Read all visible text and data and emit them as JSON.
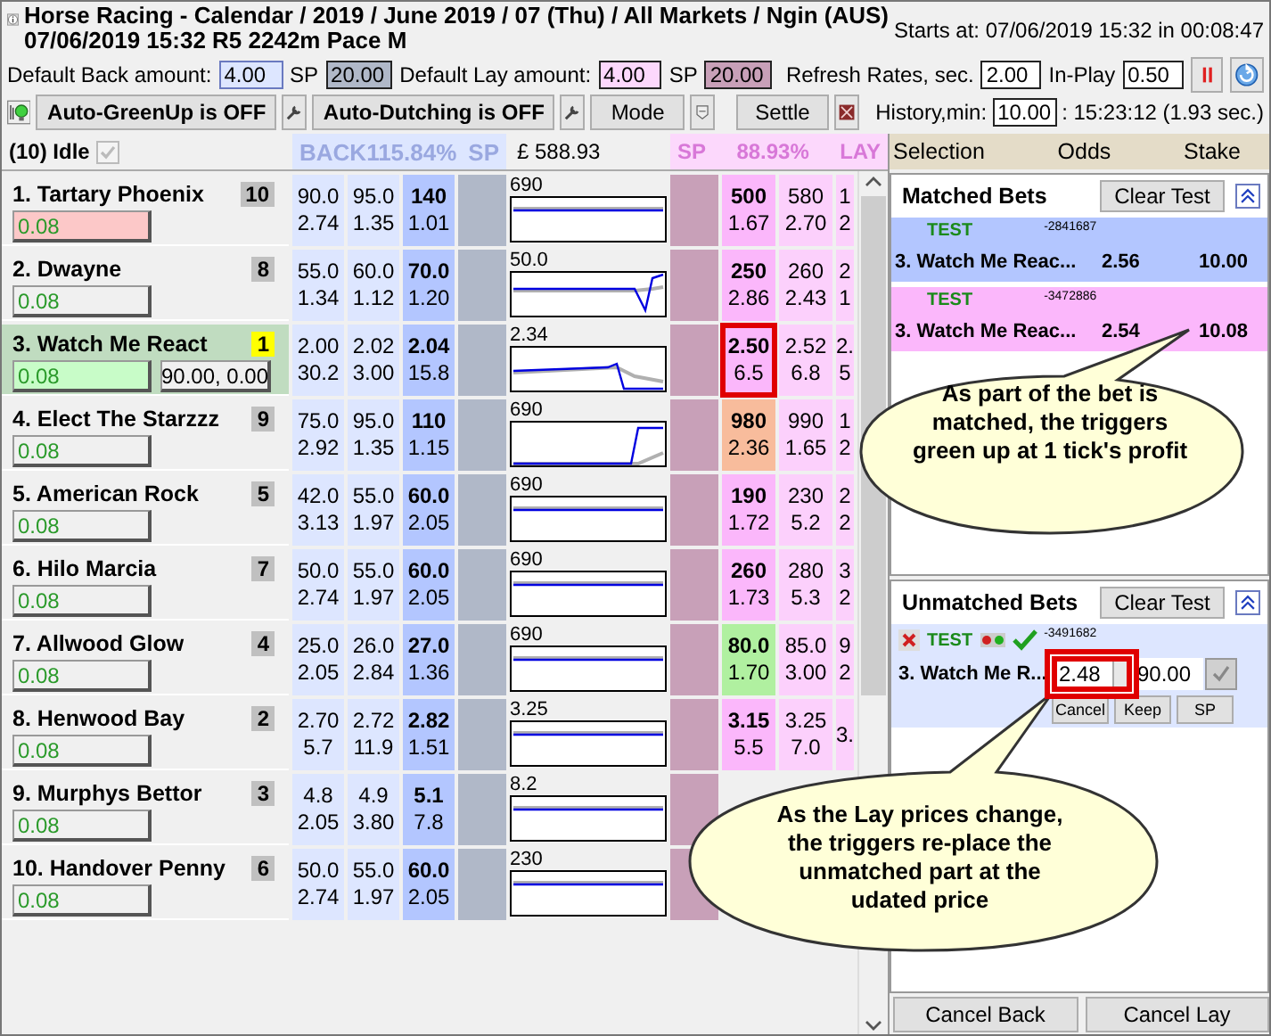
{
  "header": {
    "title": "Horse Racing - Calendar / 2019 / June 2019 / 07 (Thu) / All Markets / Ngin (AUS)",
    "subtitle": "07/06/2019 15:32 R5 2242m Pace M",
    "starts_at": "Starts at: 07/06/2019 15:32 in 00:08:47"
  },
  "defaults": {
    "back_label": "Default Back amount:",
    "back_amount": "4.00",
    "back_sp_label": "SP",
    "back_sp": "20.00",
    "lay_label": "Default Lay amount:",
    "lay_amount": "4.00",
    "lay_sp_label": "SP",
    "lay_sp": "20.00"
  },
  "refresh": {
    "label": "Refresh Rates, sec.",
    "value": "2.00",
    "inplay_label": "In-Play",
    "inplay_value": "0.50"
  },
  "toolbar": {
    "greenup": "Auto-GreenUp is OFF",
    "dutching": "Auto-Dutching is OFF",
    "mode": "Mode",
    "settle": "Settle",
    "history_label": "History,min:",
    "history_value": "10.00",
    "history_time": ": 15:23:12 (1.93 sec.)"
  },
  "market": {
    "status": "(10) Idle",
    "idle_checked": true,
    "back_label": "BACK",
    "back_pct": "115.84%",
    "back_sp": "SP",
    "total": "£ 588.93",
    "lay_sp": "SP",
    "lay_pct": "88.93%",
    "lay_label": "LAY"
  },
  "runners": [
    {
      "name": "1. Tartary Phoenix",
      "number": "10",
      "selected": false,
      "stake": "0.08",
      "stake_alert": true,
      "back": [
        {
          "price": "90.0",
          "size": "2.74"
        },
        {
          "price": "95.0",
          "size": "1.35"
        },
        {
          "price": "140",
          "size": "1.01"
        }
      ],
      "chart_label": "690",
      "kind": "flat",
      "lay": [
        {
          "price": "500",
          "size": "1.67",
          "color": "#fbb7fb",
          "highlighted": false
        },
        {
          "price": "580",
          "size": "2.70"
        },
        {
          "price": "1",
          "size": "2"
        }
      ]
    },
    {
      "name": "2. Dwayne",
      "number": "8",
      "selected": false,
      "stake": "0.08",
      "stake_alert": false,
      "back": [
        {
          "price": "55.0",
          "size": "1.34"
        },
        {
          "price": "60.0",
          "size": "1.12"
        },
        {
          "price": "70.0",
          "size": "1.20"
        }
      ],
      "chart_label": "50.0",
      "kind": "dip",
      "lay": [
        {
          "price": "250",
          "size": "2.86",
          "color": "#fbb7fb",
          "highlighted": false
        },
        {
          "price": "260",
          "size": "2.43"
        },
        {
          "price": "2",
          "size": "1"
        }
      ]
    },
    {
      "name": "3. Watch Me React",
      "number": "1",
      "selected": true,
      "stake": "0.08",
      "stake_alert": false,
      "position": "90.00, 0.00",
      "back": [
        {
          "price": "2.00",
          "size": "30.2"
        },
        {
          "price": "2.02",
          "size": "3.00"
        },
        {
          "price": "2.04",
          "size": "15.8"
        }
      ],
      "chart_label": "2.34",
      "kind": "drop",
      "lay": [
        {
          "price": "2.50",
          "size": "6.5",
          "color": "#fbb7fb",
          "highlighted": true
        },
        {
          "price": "2.52",
          "size": "6.8"
        },
        {
          "price": "2.",
          "size": "5"
        }
      ]
    },
    {
      "name": "4. Elect The Starzzz",
      "number": "9",
      "selected": false,
      "stake": "0.08",
      "stake_alert": false,
      "back": [
        {
          "price": "75.0",
          "size": "2.92"
        },
        {
          "price": "95.0",
          "size": "1.35"
        },
        {
          "price": "110",
          "size": "1.15"
        }
      ],
      "chart_label": "690",
      "kind": "rise",
      "lay": [
        {
          "price": "980",
          "size": "2.36",
          "color": "#f8bc9c",
          "highlighted": false
        },
        {
          "price": "990",
          "size": "1.65"
        },
        {
          "price": "1",
          "size": "2"
        }
      ]
    },
    {
      "name": "5. American Rock",
      "number": "5",
      "selected": false,
      "stake": "0.08",
      "stake_alert": false,
      "back": [
        {
          "price": "42.0",
          "size": "3.13"
        },
        {
          "price": "55.0",
          "size": "1.97"
        },
        {
          "price": "60.0",
          "size": "2.05"
        }
      ],
      "chart_label": "690",
      "kind": "flat",
      "lay": [
        {
          "price": "190",
          "size": "1.72",
          "color": "#fbb7fb",
          "highlighted": false
        },
        {
          "price": "230",
          "size": "5.2"
        },
        {
          "price": "2",
          "size": "2"
        }
      ]
    },
    {
      "name": "6. Hilo Marcia",
      "number": "7",
      "selected": false,
      "stake": "0.08",
      "stake_alert": false,
      "back": [
        {
          "price": "50.0",
          "size": "2.74"
        },
        {
          "price": "55.0",
          "size": "1.97"
        },
        {
          "price": "60.0",
          "size": "2.05"
        }
      ],
      "chart_label": "690",
      "kind": "flat",
      "lay": [
        {
          "price": "260",
          "size": "1.73",
          "color": "#fbb7fb",
          "highlighted": false
        },
        {
          "price": "280",
          "size": "5.3"
        },
        {
          "price": "3",
          "size": "2"
        }
      ]
    },
    {
      "name": "7. Allwood Glow",
      "number": "4",
      "selected": false,
      "stake": "0.08",
      "stake_alert": false,
      "back": [
        {
          "price": "25.0",
          "size": "2.05"
        },
        {
          "price": "26.0",
          "size": "2.84"
        },
        {
          "price": "27.0",
          "size": "1.36"
        }
      ],
      "chart_label": "690",
      "kind": "flat",
      "lay": [
        {
          "price": "80.0",
          "size": "1.70",
          "color": "#b0f0a0",
          "highlighted": false
        },
        {
          "price": "85.0",
          "size": "3.00"
        },
        {
          "price": "9",
          "size": "2"
        }
      ]
    },
    {
      "name": "8. Henwood Bay",
      "number": "2",
      "selected": false,
      "stake": "0.08",
      "stake_alert": false,
      "back": [
        {
          "price": "2.70",
          "size": "5.7"
        },
        {
          "price": "2.72",
          "size": "11.9"
        },
        {
          "price": "2.82",
          "size": "1.51"
        }
      ],
      "chart_label": "3.25",
      "kind": "flat",
      "lay": [
        {
          "price": "3.15",
          "size": "5.5",
          "color": "#fbb7fb",
          "highlighted": false
        },
        {
          "price": "3.25",
          "size": "7.0"
        },
        {
          "price": "3."
        }
      ]
    },
    {
      "name": "9. Murphys Bettor",
      "number": "3",
      "selected": false,
      "stake": "0.08",
      "stake_alert": false,
      "back": [
        {
          "price": "4.8",
          "size": "2.05"
        },
        {
          "price": "4.9",
          "size": "3.80"
        },
        {
          "price": "5.1",
          "size": "7.8"
        }
      ],
      "chart_label": "8.2",
      "kind": "flat"
    },
    {
      "name": "10. Handover Penny",
      "number": "6",
      "selected": false,
      "stake": "0.08",
      "stake_alert": false,
      "back": [
        {
          "price": "50.0",
          "size": "2.74"
        },
        {
          "price": "55.0",
          "size": "1.97"
        },
        {
          "price": "60.0",
          "size": "2.05"
        }
      ],
      "chart_label": "230",
      "kind": "flat"
    }
  ],
  "bet_columns": [
    "Selection",
    "Odds",
    "Stake"
  ],
  "matched": {
    "title": "Matched Bets",
    "clear": "Clear Test",
    "bets": [
      {
        "kind": "back",
        "tag": "TEST",
        "ref": "-2841687",
        "selection": "3. Watch Me Reac...",
        "odds": "2.56",
        "stake": "10.00"
      },
      {
        "kind": "lay",
        "tag": "TEST",
        "ref": "-3472886",
        "selection": "3. Watch Me Reac...",
        "odds": "2.54",
        "stake": "10.08"
      }
    ]
  },
  "unmatched": {
    "title": "Unmatched Bets",
    "clear": "Clear Test",
    "bet": {
      "tag": "TEST",
      "ref": "-3491682",
      "selection": "3. Watch Me R...",
      "odds": "2.48",
      "odds_highlighted": true,
      "stake": "90.00",
      "buttons": [
        "Cancel",
        "Keep",
        "SP"
      ]
    }
  },
  "footer": [
    "Cancel Back",
    "Cancel Lay"
  ],
  "callouts": [
    {
      "text": "As part of the bet is matched, the triggers green up at 1 tick's profit"
    },
    {
      "text": "As the Lay prices change, the triggers re-place the unmatched part at the udated price"
    }
  ]
}
